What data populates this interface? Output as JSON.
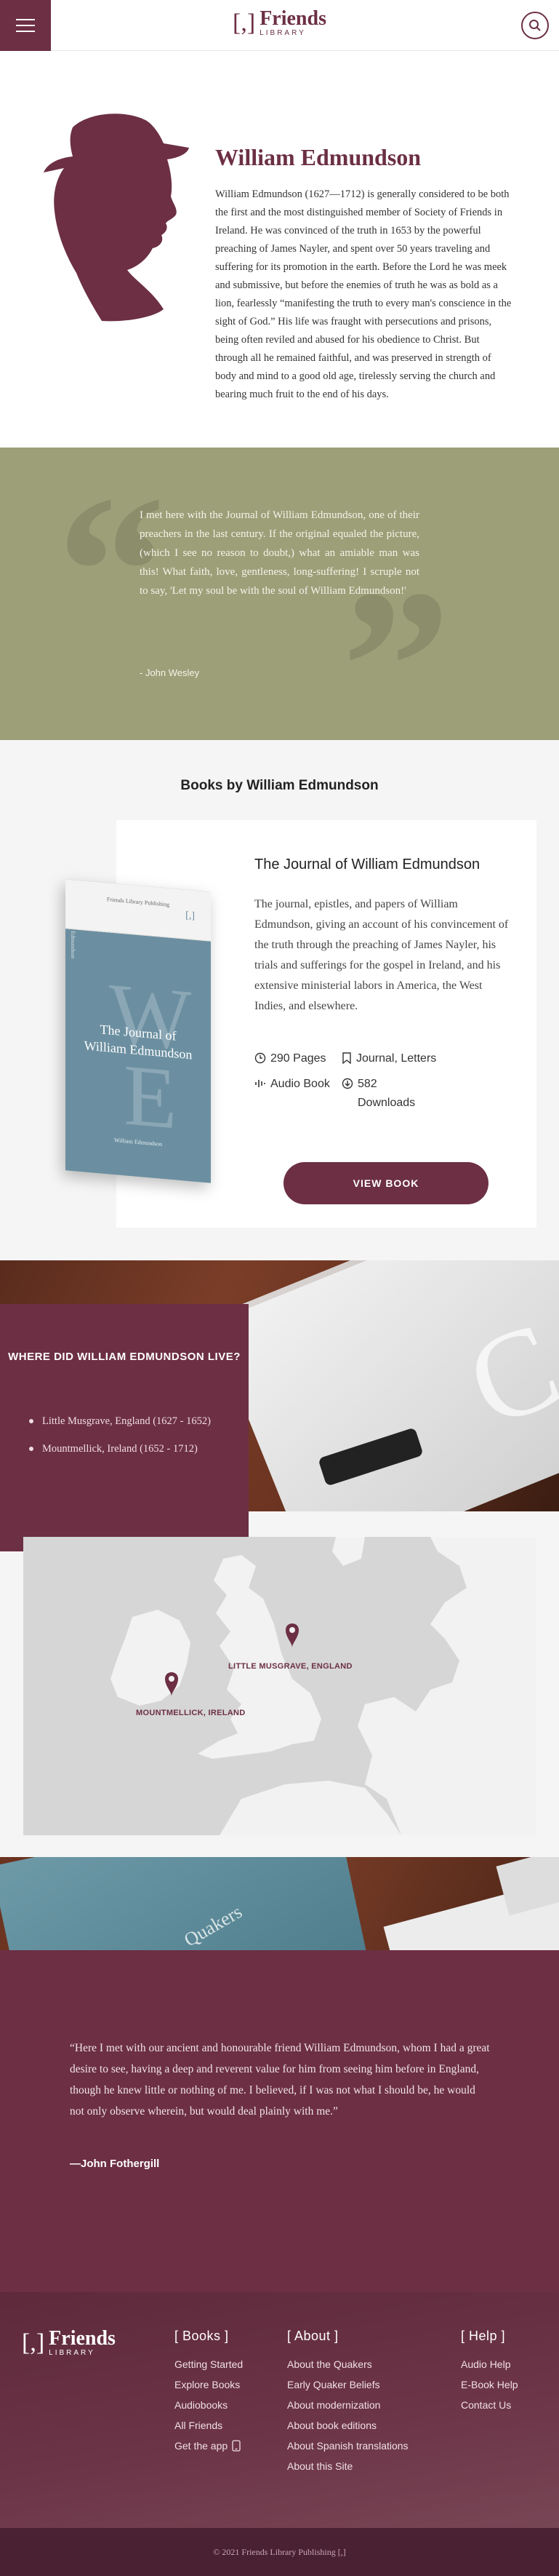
{
  "header": {
    "logo_mark": "[,]",
    "logo_title": "Friends",
    "logo_sub": "LIBRARY"
  },
  "author": {
    "name": "William Edmundson",
    "bio": "William Edmundson (1627—1712) is generally considered to be both the first and the most distinguished member of Society of Friends in Ireland. He was convinced of the truth in 1653 by the powerful preaching of James Nayler, and spent over 50 years traveling and suffering for its promotion in the earth. Before the Lord he was meek and submissive, but before the enemies of truth he was as bold as a lion, fearlessly “manifesting the truth to every man's conscience in the sight of God.” His life was fraught with persecutions and prisons, being often reviled and abused for his obedience to Christ. But through all he remained faithful, and was preserved in strength of body and mind to a good old age, tirelessly serving the church and bearing much fruit to the end of his days."
  },
  "quote": {
    "text": "I met here with the Journal of William Edmundson, one of their preachers in the last century. If the original equaled the picture, (which I see no reason to doubt,) what an amiable man was this! What faith, love, gentleness, long-suffering! I scruple not to say, 'Let my soul be with the soul of William Edmundson!'",
    "cite": "- John Wesley"
  },
  "books": {
    "heading": "Books by William Edmundson",
    "items": [
      {
        "title": "The Journal of William Edmundson",
        "description": "The journal, epistles, and papers of William Edmundson, giving an account of his convincement of the truth through the preaching of James Nayler, his trials and sufferings for the gospel in Ireland, and his extensive ministerial labors in America, the West Indies, and elsewhere.",
        "pages": "290 Pages",
        "tags": "Journal, Letters",
        "audio": "Audio Book",
        "downloads": "582 Downloads",
        "button": "VIEW BOOK",
        "cover": {
          "publisher": "Friends Library Publishing",
          "mark": "[,]",
          "title": "The Journal of William Edmundson",
          "author": "William Edmundson",
          "initial_1": "W",
          "initial_2": "E",
          "spine": "Edmundson"
        }
      }
    ]
  },
  "residences": {
    "title": "WHERE DID WILLIAM EDMUNDSON LIVE?",
    "places": [
      "Little Musgrave, England (1627 - 1652)",
      "Mountmellick, Ireland (1652 - 1712)"
    ],
    "map_labels": [
      "LITTLE MUSGRAVE, ENGLAND",
      "MOUNTMELLICK, IRELAND"
    ]
  },
  "photo_strip": {
    "text": "Quakers"
  },
  "testimonial": {
    "text": "“Here I met with our ancient and honourable friend William Edmundson, whom I had a great desire to see, having a deep and reverent value for him from seeing him before in England, though he knew little or nothing of me. I believed, if I was not what I should be, he would not only observe wherein, but would deal plainly with me.”",
    "cite": "—John Fothergill"
  },
  "footer": {
    "columns": [
      {
        "title": "[ Books ]",
        "links": [
          "Getting Started",
          "Explore Books",
          "Audiobooks",
          "All Friends",
          "Get the app"
        ]
      },
      {
        "title": "[ About ]",
        "links": [
          "About the Quakers",
          "Early Quaker Beliefs",
          "About modernization",
          "About book editions",
          "About Spanish translations",
          "About this Site"
        ]
      },
      {
        "title": "[ Help ]",
        "links": [
          "Audio Help",
          "E-Book Help",
          "Contact Us"
        ]
      }
    ],
    "copyright": "© 2021 Friends Library Publishing [,]"
  },
  "colors": {
    "brand": "#6c2f44",
    "olive": "#9c9f78",
    "light_bg": "#f5f5f5"
  }
}
